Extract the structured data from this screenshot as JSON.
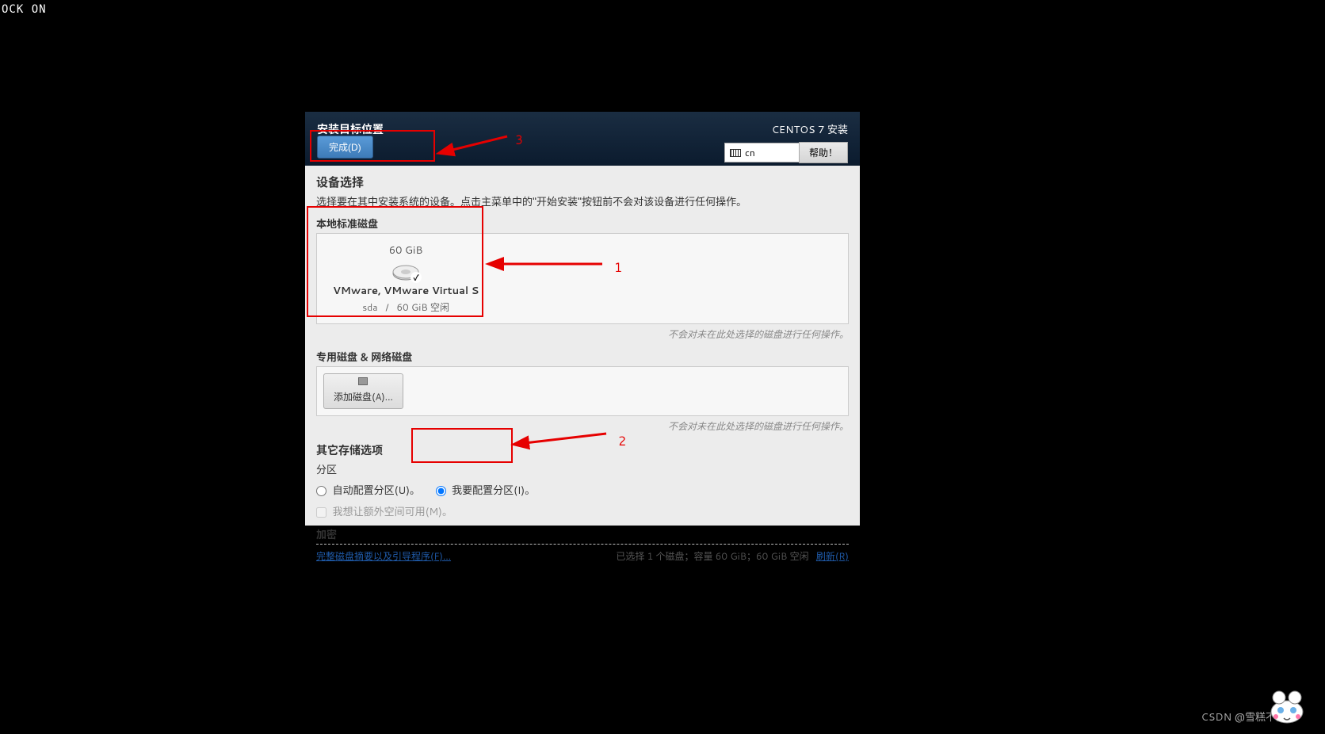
{
  "lock_text": "OCK ON",
  "header": {
    "title": "安装目标位置",
    "done_label": "完成(D)",
    "centos_label": "CENTOS 7 安装",
    "keyboard_layout": "cn",
    "help_label": "帮助！"
  },
  "device_selection": {
    "title": "设备选择",
    "desc": "选择要在其中安装系统的设备。点击主菜单中的\"开始安装\"按钮前不会对该设备进行任何操作。"
  },
  "local_disks": {
    "title": "本地标准磁盘",
    "disk": {
      "size": "60 GiB",
      "name": "VMware, VMware Virtual S",
      "dev": "sda",
      "sep": "/",
      "free": "60 GiB 空闲"
    },
    "note": "不会对未在此处选择的磁盘进行任何操作。"
  },
  "special_disks": {
    "title": "专用磁盘 & 网络磁盘",
    "add_button": "添加磁盘(A)...",
    "note": "不会对未在此处选择的磁盘进行任何操作。"
  },
  "storage_options": {
    "title": "其它存储选项",
    "partition_title": "分区",
    "auto_label": "自动配置分区(U)。",
    "manual_label": "我要配置分区(I)。",
    "extra_space_label": "我想让额外空间可用(M)。",
    "encrypt_title": "加密"
  },
  "footer": {
    "summary_link": "完整磁盘摘要以及引导程序(F)...",
    "status": "已选择 1 个磁盘；容量 60 GiB；60 GiB 空闲",
    "refresh_link": "刷新(R)"
  },
  "annotations": {
    "a1": "1",
    "a2": "2",
    "a3": "3"
  },
  "watermark": "CSDN @雪糕不要气"
}
